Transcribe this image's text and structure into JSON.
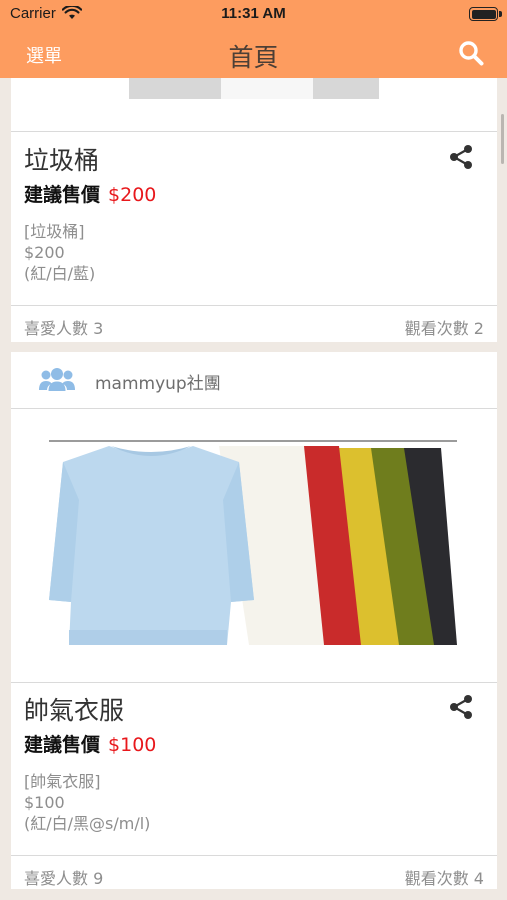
{
  "status_bar": {
    "carrier": "Carrier",
    "time": "11:31 AM"
  },
  "nav": {
    "menu_label": "選單",
    "title": "首頁"
  },
  "posts": [
    {
      "title": "垃圾桶",
      "price_label": "建議售價",
      "price": "$200",
      "desc_lines": [
        "[垃圾桶]",
        "$200",
        "(紅/白/藍)"
      ],
      "likes": "喜愛人數 3",
      "views": "觀看次數 2"
    },
    {
      "group_name": "mammyup社團",
      "title": "帥氣衣服",
      "price_label": "建議售價",
      "price": "$100",
      "desc_lines": [
        "[帥氣衣服]",
        "$100",
        "(紅/白/黑@s/m/l)"
      ],
      "likes": "喜愛人數 9",
      "views": "觀看次數 4"
    }
  ],
  "colors": {
    "nav_bg": "#fd9c5f",
    "price": "#e8181c",
    "group_icon": "#8fbce6",
    "background": "#efe9e3"
  }
}
